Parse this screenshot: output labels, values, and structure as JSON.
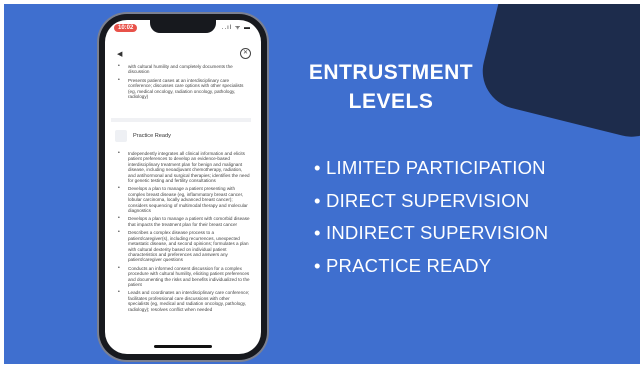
{
  "slide": {
    "title_line1": "ENTRUSTMENT",
    "title_line2": "LEVELS",
    "levels": [
      "• LIMITED PARTICIPATION",
      "• DIRECT SUPERVISION",
      "• INDIRECT SUPERVISION",
      "• PRACTICE READY"
    ],
    "colors": {
      "background": "#3f6fcf",
      "accent_shape": "#1d2c4c",
      "text": "#ffffff"
    }
  },
  "phone": {
    "status_time": "10:02",
    "status_icons": "..ıl ᯤ ▬",
    "back_icon": "back-arrow-icon",
    "close_icon": "close-circle-icon",
    "upper_items": [
      "with cultural humility and completely documents the discussion",
      "Presents patient cases at an interdisciplinary care conference; discusses care options with other specialists (eg, medical oncology, radiation oncology, pathology, radiology)"
    ],
    "section_title": "Practice Ready",
    "lower_items": [
      "Independently integrates all clinical information and elicits patient preferences to develop an evidence-based interdisciplinary treatment plan for benign and malignant disease, including neoadjuvant chemotherapy, radiation, and antihormonal and surgical therapies; identifies the need for genetic testing and fertility consultations",
      "Develops a plan to manage a patient presenting with complex breast disease (eg, inflammatory breast cancer, lobular carcinoma, locally advanced breast cancer); considers sequencing of multimodal therapy and molecular diagnostics",
      "Develops a plan to manage a patient with comorbid disease that impacts the treatment plan for their breast cancer",
      "Describes a complex disease process to a patient/caregiver(s), including recurrences, unexpected metastatic disease, and second opinions; formulates a plan with cultural dexterity based on individual patient characteristics and preferences and answers any patient/caregiver questions",
      "Conducts an informed consent discussion for a complex procedure with cultural humility, eliciting patient preferences and documenting the risks and benefits individualized to the patient",
      "Leads and coordinates an interdisciplinary care conference; facilitates professional care discussions with other specialists (eg, medical and radiation oncology, pathology, radiology); resolves conflict when needed"
    ]
  }
}
